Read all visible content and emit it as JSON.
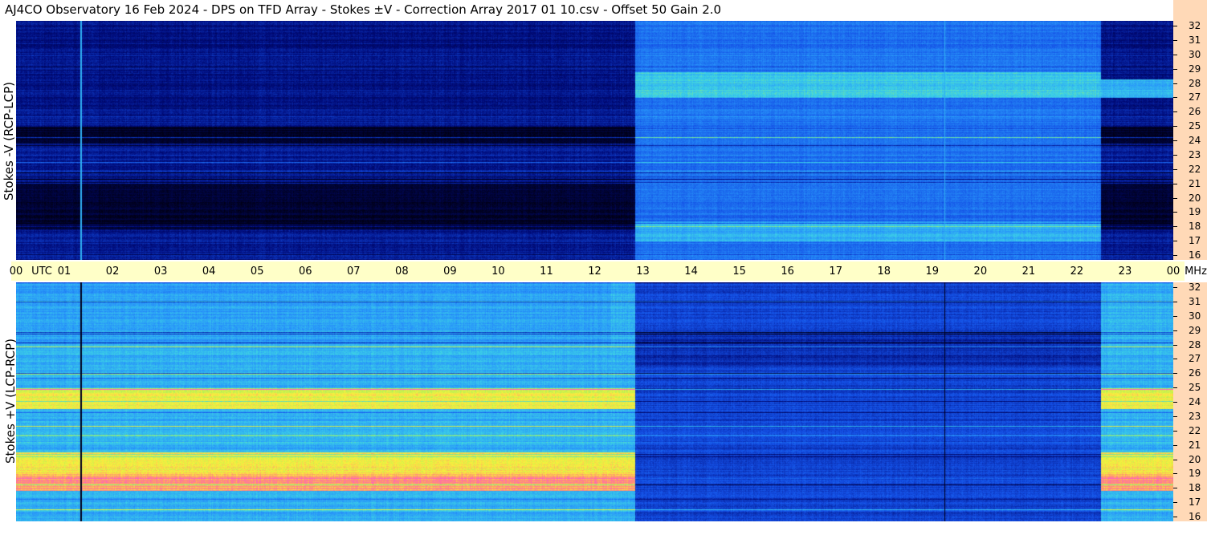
{
  "header": {
    "title": "AJ4CO Observatory  16 Feb 2024  -  DPS on TFD Array  -  Stokes ±V  -  Correction Array 2017 01 10.csv  -  Offset 50  Gain 2.0"
  },
  "chart_data": [
    {
      "type": "heatmap",
      "panel": "top",
      "ylabel": "Stokes -V (RCP-LCP)",
      "x_unit": "UTC",
      "y_unit": "MHz",
      "xlim": [
        0,
        24
      ],
      "ylim": [
        16,
        32
      ],
      "grid": false,
      "notes": [
        "vertical bright line near 01:20 UTC",
        "vertical bright line near 19:15 UTC",
        "dark band 24-25 MHz before 12:50 UTC",
        "emission bands 27-28.5 MHz after 12:50 UTC"
      ]
    },
    {
      "type": "heatmap",
      "panel": "bottom",
      "ylabel": "Stokes +V (LCP-RCP)",
      "x_unit": "UTC",
      "y_unit": "MHz",
      "xlim": [
        0,
        24
      ],
      "ylim": [
        16,
        32
      ],
      "grid": false,
      "notes": [
        "dark vertical line near 01:20 UTC",
        "dark vertical line near 19:15 UTC",
        "strong emission 18-19 MHz and 24 MHz before 12:50 UTC"
      ]
    }
  ],
  "x_axis": {
    "ticks": [
      "00",
      "01",
      "02",
      "03",
      "04",
      "05",
      "06",
      "07",
      "08",
      "09",
      "10",
      "11",
      "12",
      "13",
      "14",
      "15",
      "16",
      "17",
      "18",
      "19",
      "20",
      "21",
      "22",
      "23",
      "00"
    ],
    "utc_label": "UTC",
    "mhz_label": "MHz"
  },
  "y_axis": {
    "ticks": [
      "32",
      "31",
      "30",
      "29",
      "28",
      "27",
      "26",
      "25",
      "24",
      "23",
      "22",
      "21",
      "20",
      "19",
      "18",
      "17",
      "16"
    ]
  },
  "colors": {
    "axis_band": "#ffffc8",
    "freq_band": "#ffd9b7"
  }
}
